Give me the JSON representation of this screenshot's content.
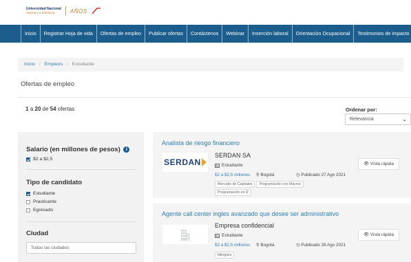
{
  "header": {
    "logo_line1": "Universidad Nacional",
    "logo_line2": "Abierta y a Distancia",
    "logo_anos": "AÑOS"
  },
  "nav": {
    "items": [
      "Inicio",
      "Registrar Hoja de vida",
      "Ofertas de empleo",
      "Publicar ofertas",
      "Contáctenos",
      "Webinar",
      "Inserción laboral",
      "Orientación Ocupacional",
      "Testimonios de impacto"
    ]
  },
  "breadcrumb": {
    "home": "Inicio",
    "jobs": "Empleos",
    "current": "Estudiante",
    "sep": "/"
  },
  "page_title": "Ofertas de empleo",
  "results": {
    "from": "1",
    "a": "a",
    "to": "20",
    "de": "de",
    "total": "54",
    "suffix": "ofertas"
  },
  "sort": {
    "label": "Ordenar por:",
    "value": "Relevancia"
  },
  "filters": {
    "salary_title": "Salario (en millones de pesos)",
    "salary_options": [
      {
        "label": "$2 a $2,5",
        "checked": true
      }
    ],
    "candidate_title": "Tipo de candidato",
    "candidate_options": [
      {
        "label": "Estudiante",
        "checked": true
      },
      {
        "label": "Practicante",
        "checked": false
      },
      {
        "label": "Egresado",
        "checked": false
      }
    ],
    "city_title": "Ciudad",
    "city_placeholder": "Todas las ciudades"
  },
  "jobs": [
    {
      "title": "Analista de riesgo financiero",
      "company": "SERDAN SA",
      "company_logo_text": "SERDAN",
      "level": "Estudiante",
      "salary": "$2 a $2,5 millones",
      "location": "Bogotá",
      "date": "Publicado 27 Ago 2021",
      "tags": [
        "Mercado de Capitales",
        "Programación con Macros",
        "Programación en R"
      ],
      "quick_view": "Vista rápida"
    },
    {
      "title": "Agente call center ingles avanzado que desee ser administrativo",
      "company": "Empresa confidencial",
      "level": "Estudiante",
      "salary": "$2 a $2,5 millones",
      "location": "Bogotá",
      "date": "Publicado 26 Ago 2021",
      "tags": [
        "bilingües"
      ],
      "quick_view": "Vista rápida"
    }
  ],
  "colors": {
    "nav_bg": "#1b5d8c",
    "link": "#2f7db8",
    "serdan_blue": "#1d3f7a",
    "serdan_orange": "#f39c1f"
  }
}
